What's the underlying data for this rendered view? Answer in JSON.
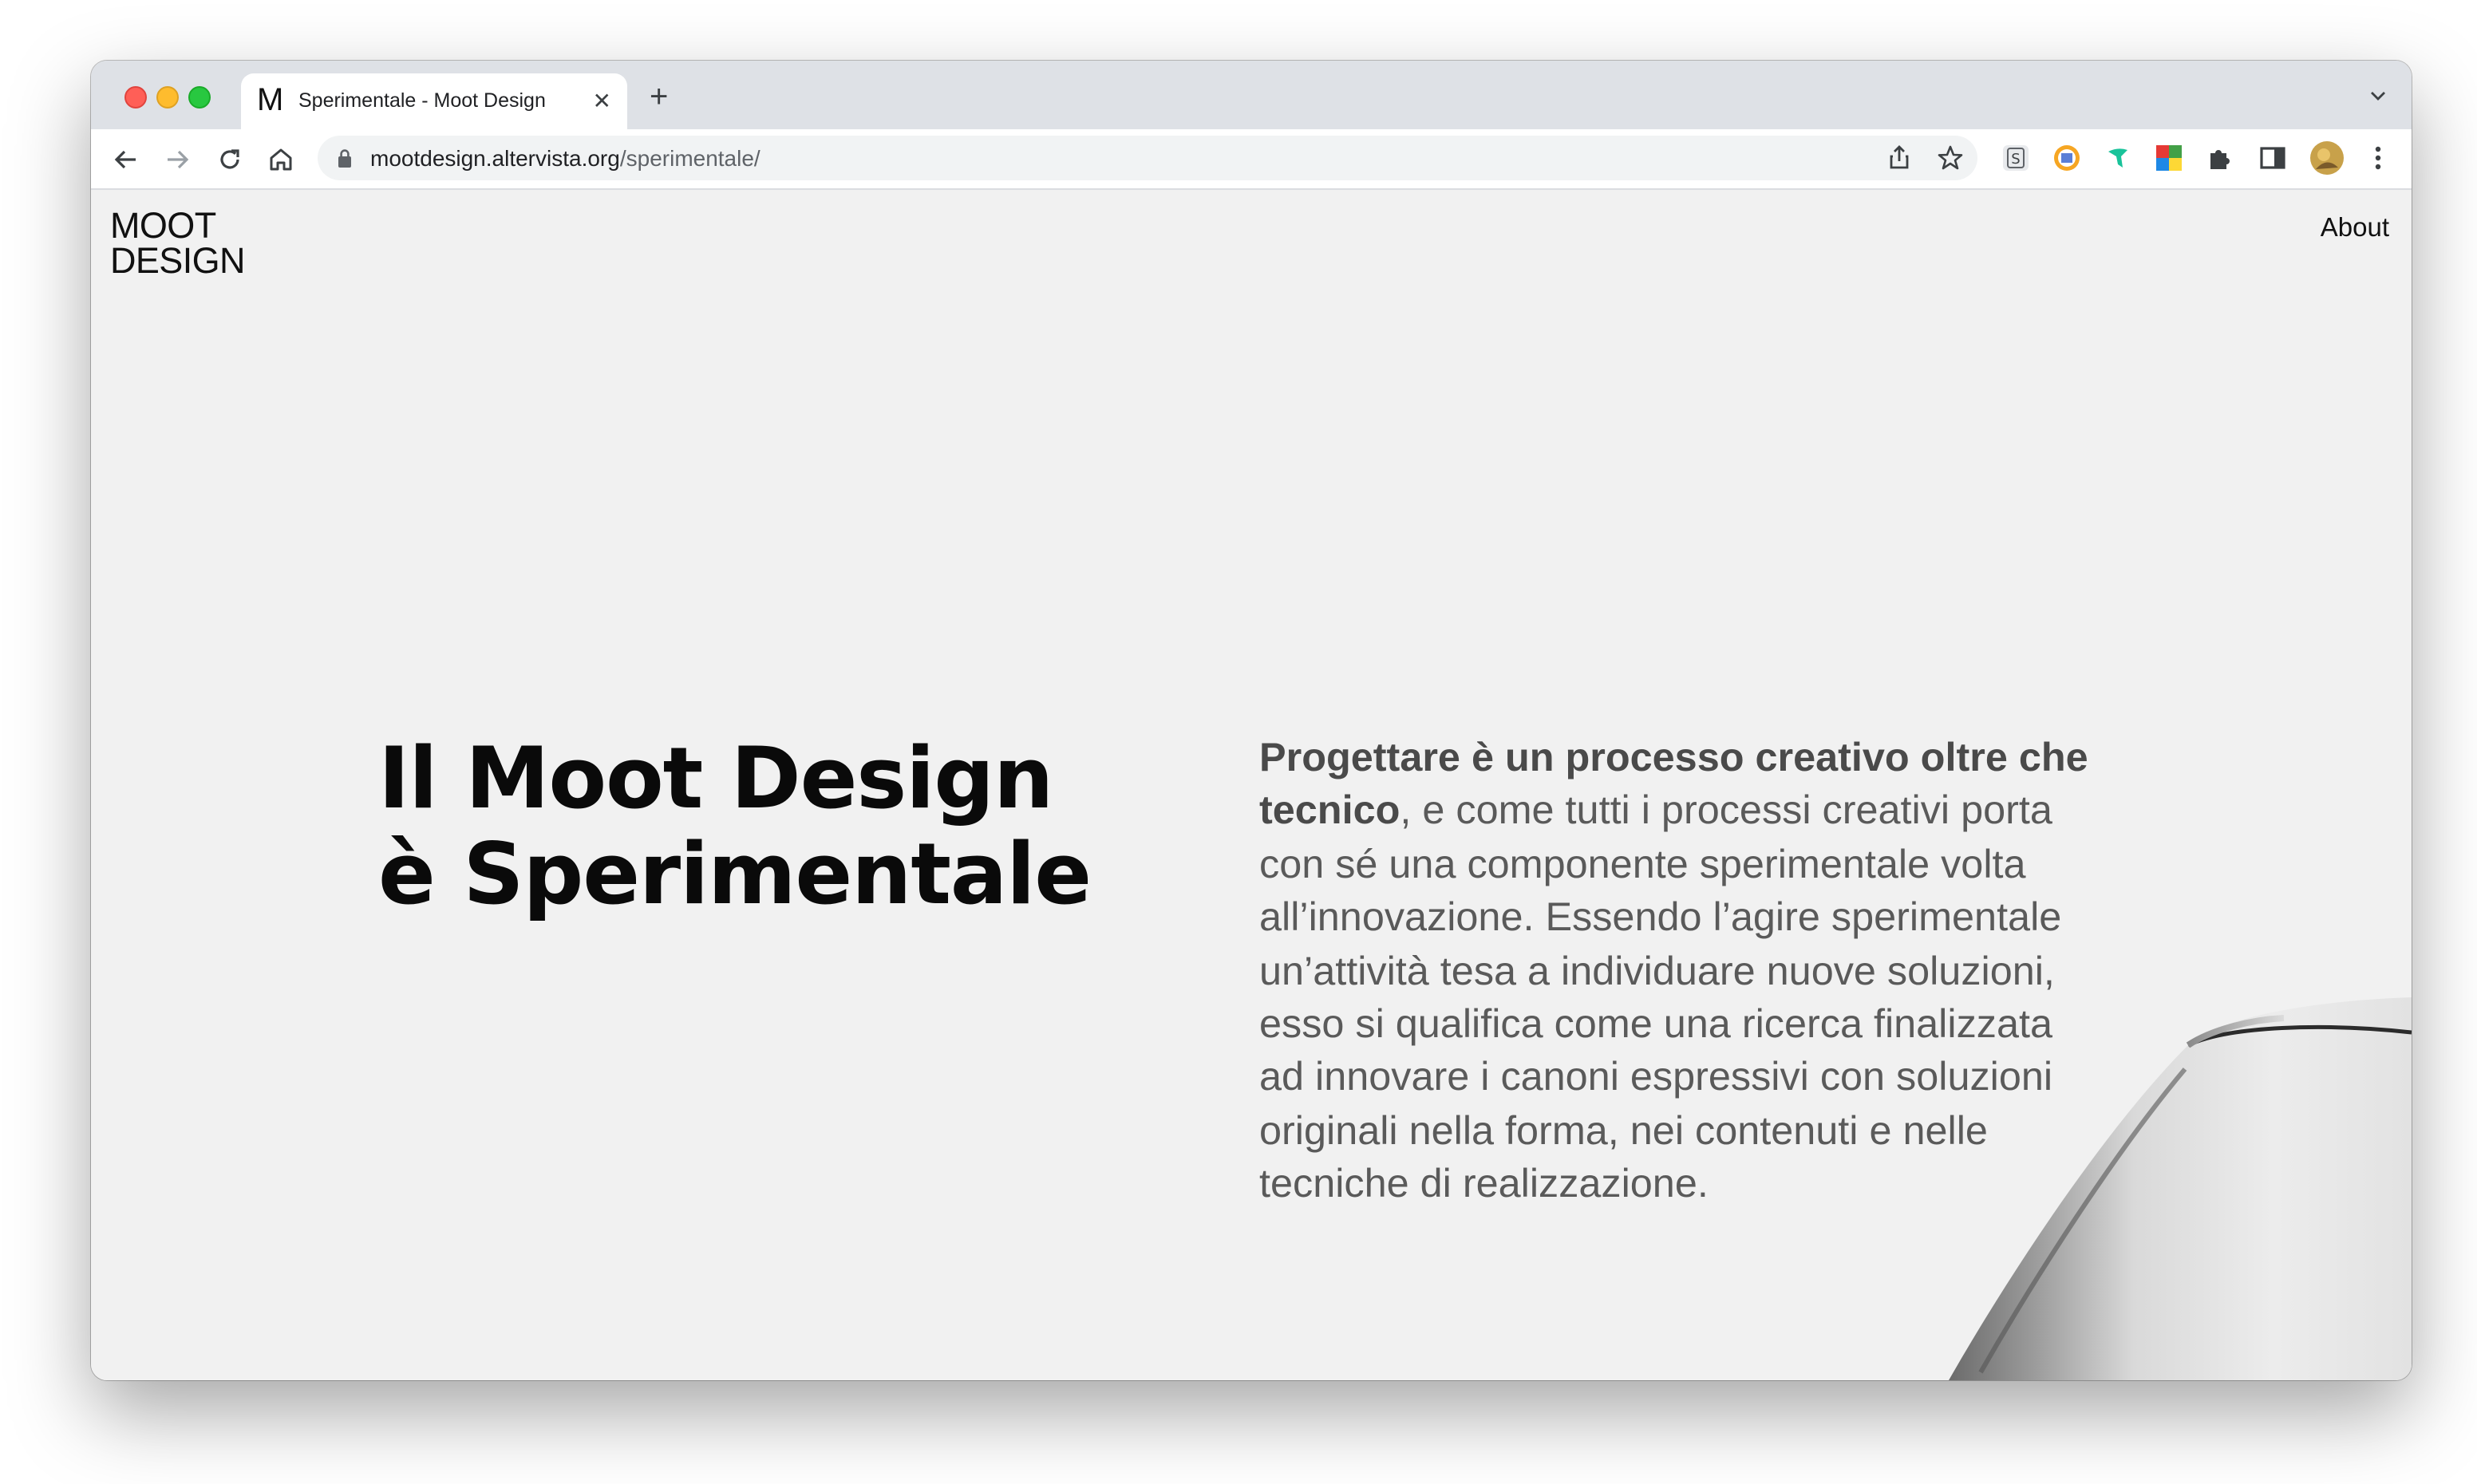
{
  "browser": {
    "tab": {
      "favicon": "M",
      "title": "Sperimentale - Moot Design",
      "close": "✕"
    },
    "new_tab": "+",
    "url_host": "mootdesign.altervista.org",
    "url_path": "/sperimentale/",
    "icons": [
      "back-arrow-icon",
      "forward-arrow-icon",
      "reload-icon",
      "home-icon",
      "lock-icon",
      "share-icon",
      "star-icon",
      "extensions-icon",
      "side-panel-icon",
      "more-icon"
    ],
    "colors": {
      "tabstrip": "#dee1e6",
      "toolbar": "#ffffff",
      "omnibox": "#f1f3f4"
    }
  },
  "site": {
    "logo_line1": "MOOT",
    "logo_line2": "DESIGN",
    "nav_about": "About",
    "headline_line1": "Il Moot Design",
    "headline_line2": "è Sperimentale",
    "body_bold": "Progettare è un processo creativo oltre che tecnico",
    "body_rest": ", e come tutti i processi creativi porta con sé una componente sperimentale volta all’innovazione. Essendo l’agire sperimentale un’attività tesa a individuare nuove soluzioni, esso si qualifica come una ricerca finalizzata ad innovare i canoni espressivi con soluzioni originali nella forma, nei contenuti e nelle tecniche di realizzazione.",
    "background": "#f1f1f1"
  }
}
